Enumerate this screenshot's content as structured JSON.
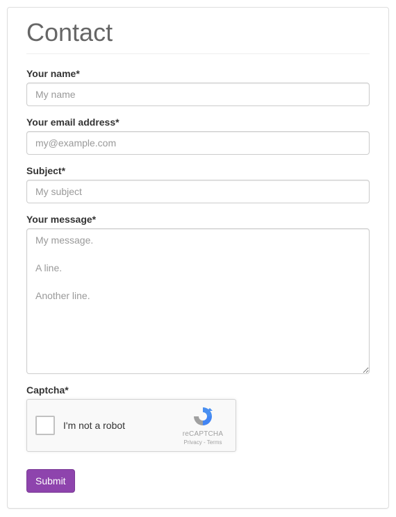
{
  "page": {
    "title": "Contact"
  },
  "form": {
    "name": {
      "label": "Your name*",
      "placeholder": "My name",
      "value": ""
    },
    "email": {
      "label": "Your email address*",
      "placeholder": "my@example.com",
      "value": ""
    },
    "subject": {
      "label": "Subject*",
      "placeholder": "My subject",
      "value": ""
    },
    "message": {
      "label": "Your message*",
      "placeholder": "My message.\n\nA line.\n\nAnother line.",
      "value": ""
    },
    "captcha": {
      "label": "Captcha*",
      "checkbox_label": "I'm not a robot",
      "brand": "reCAPTCHA",
      "privacy": "Privacy",
      "terms": "Terms"
    },
    "submit_label": "Submit"
  }
}
